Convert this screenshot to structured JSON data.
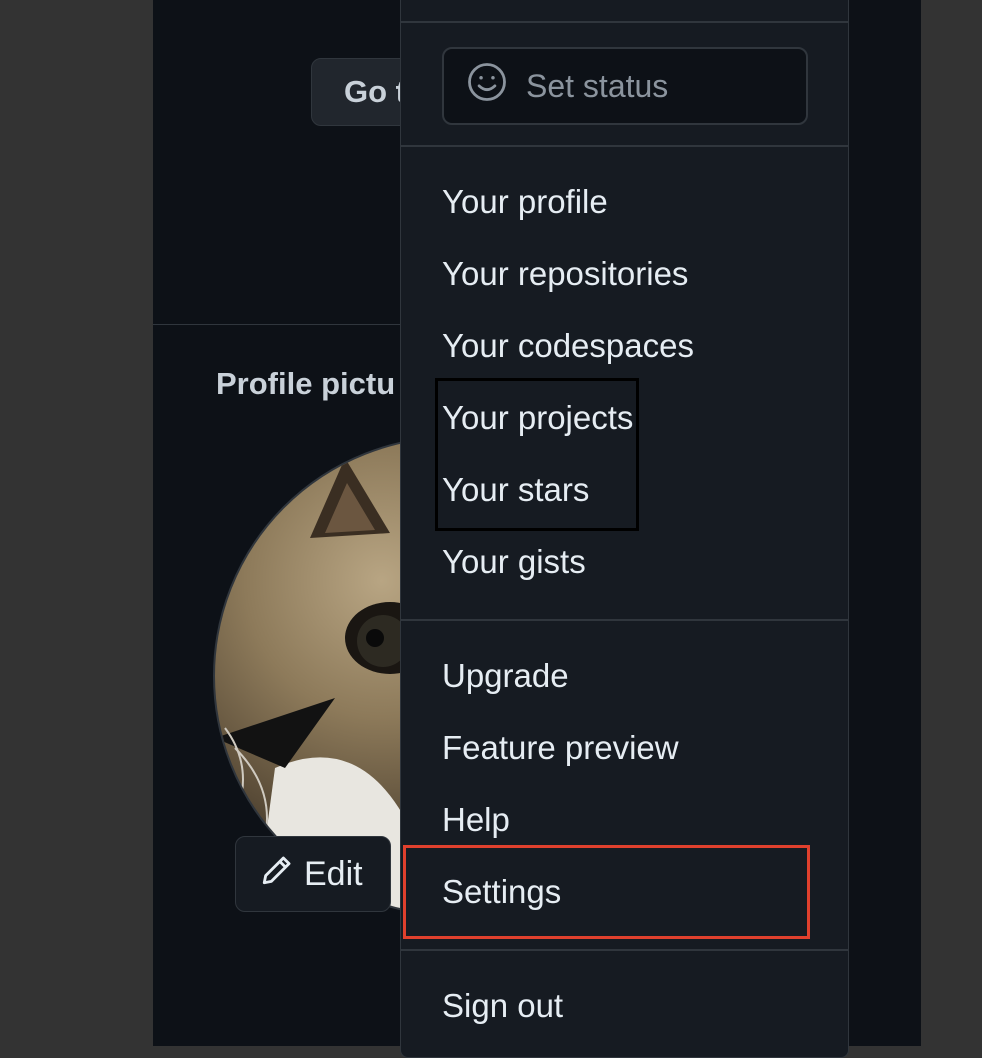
{
  "background": {
    "goto_button_label": "Go t",
    "profile_heading": "Profile pictu",
    "edit_label": "Edit"
  },
  "dropdown": {
    "status_placeholder": "Set status",
    "group1": [
      "Your profile",
      "Your repositories",
      "Your codespaces",
      "Your projects",
      "Your stars",
      "Your gists"
    ],
    "group2": [
      "Upgrade",
      "Feature preview",
      "Help",
      "Settings"
    ],
    "sign_out": "Sign out"
  },
  "icons": {
    "status": "smiley-icon",
    "edit": "pencil-icon"
  },
  "colors": {
    "highlight_selected": "#e0402d",
    "highlight_secondary": "#000000",
    "menu_background": "#161b22",
    "page_background": "#0d1117"
  }
}
